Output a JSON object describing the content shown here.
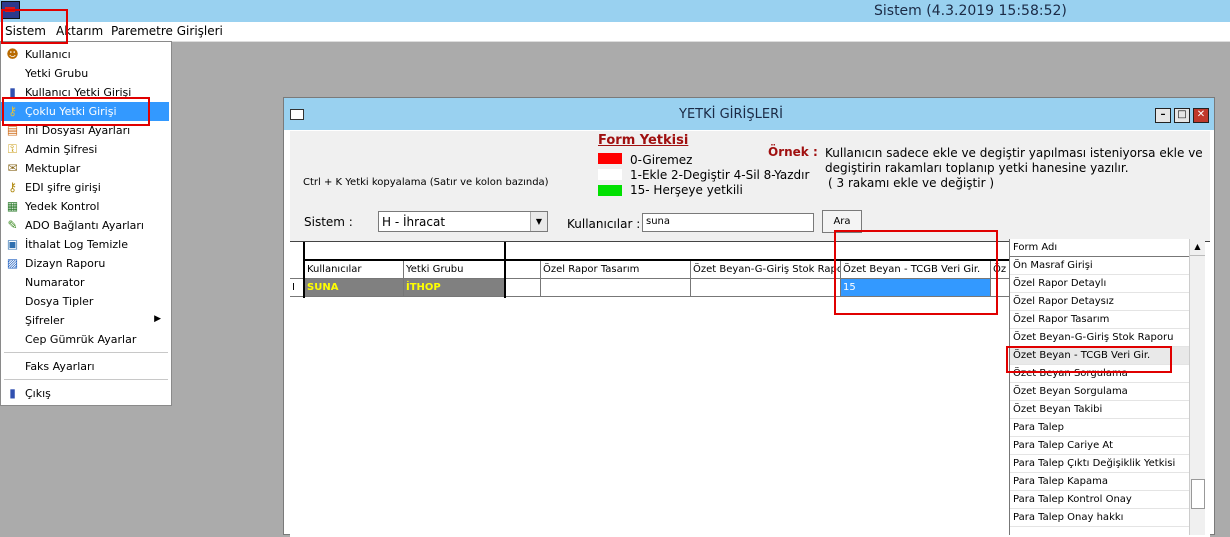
{
  "window": {
    "title": "Sistem (4.3.2019 15:58:52)"
  },
  "menubar": [
    "Sistem",
    "Aktarım",
    "Paremetre Girişleri"
  ],
  "dropdown": [
    {
      "label": "Kullanıcı",
      "icon": "user-icon"
    },
    {
      "label": "Yetki Grubu",
      "icon": ""
    },
    {
      "label": "Kullanıcı Yetki Girişi",
      "icon": "user-key-icon"
    },
    {
      "label": "Çoklu Yetki Girişi",
      "icon": "multi-key-icon"
    },
    {
      "label": "Ini Dosyası Ayarları",
      "icon": "ini-file-icon"
    },
    {
      "label": "Admin Şifresi",
      "icon": "key-icon"
    },
    {
      "label": "Mektuplar",
      "icon": "letter-icon"
    },
    {
      "label": "EDI şifre girişi",
      "icon": "edi-key-icon"
    },
    {
      "label": "Yedek Kontrol",
      "icon": "backup-icon"
    },
    {
      "label": "ADO Bağlantı Ayarları",
      "icon": "connection-icon"
    },
    {
      "label": "İthalat Log Temizle",
      "icon": "log-clean-icon"
    },
    {
      "label": "Dizayn Raporu",
      "icon": "report-icon"
    },
    {
      "label": "Numarator",
      "icon": ""
    },
    {
      "label": "Dosya Tipler",
      "icon": ""
    },
    {
      "label": "Şifreler",
      "icon": ""
    },
    {
      "label": "Cep Gümrük Ayarlar",
      "icon": ""
    },
    {
      "label": "Faks Ayarları",
      "icon": ""
    },
    {
      "label": "Çıkış",
      "icon": "exit-icon"
    }
  ],
  "dialog": {
    "title": "YETKİ GİRİŞLERİ",
    "form_yetkisi": "Form Yetkisi",
    "legend": [
      {
        "color": "#ff0000",
        "text": "0-Giremez"
      },
      {
        "color": "#ffffff",
        "text": "1-Ekle  2-Degiştir  4-Sil  8-Yazdır"
      },
      {
        "color": "#00e000",
        "text": "15- Herşeye yetkili"
      }
    ],
    "ornek_label": "Örnek :",
    "ornek_text": "Kullanıcın sadece ekle ve degiştir yapılması isteniyorsa  ekle ve degiştirin rakamları toplanıp yetki hanesine yazılır.",
    "ornek_sub": "( 3 rakamı ekle ve değiştir )",
    "copy_hint": "Ctrl + K Yetki kopyalama (Satır ve kolon bazında)",
    "sistem_label": "Sistem :",
    "sistem_value": "H - İhracat",
    "kullanicilar_label": "Kullanıcılar :",
    "kullanicilar_value": "suna",
    "ara_label": "Ara",
    "grid_headers": [
      "Kullanıcılar",
      "Yetki Grubu",
      "",
      "Özel Rapor Tasarım",
      "Özet Beyan-G-Giriş Stok Rapor",
      "Özet Beyan - TCGB Veri Gir.",
      "Öz"
    ],
    "grid_row": {
      "marker": "I",
      "user": "SUNA",
      "group": "İTHOP",
      "value": "15"
    },
    "form_adi_header": "Form Adı",
    "forms": [
      "Ön Masraf Girişi",
      "Özel Rapor Detaylı",
      "Özel Rapor Detaysız",
      "Özel Rapor Tasarım",
      "Özet Beyan-G-Giriş Stok Raporu",
      "Özet Beyan - TCGB Veri Gir.",
      "Özet Beyan Sorgulama",
      "Özet Beyan Sorgulama",
      "Özet Beyan Takibi",
      "Para Talep",
      "Para Talep Cariye At",
      "Para Talep Çıktı Değişiklik Yetkisi",
      "Para Talep Kapama",
      "Para Talep Kontrol Onay",
      "Para Talep Onay hakkı"
    ]
  }
}
